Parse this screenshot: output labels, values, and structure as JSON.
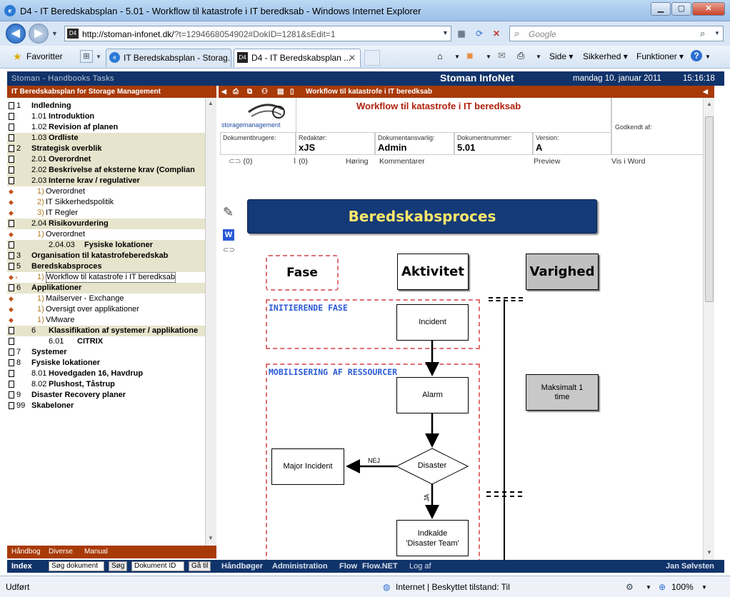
{
  "window": {
    "title": "D4 - IT Beredskabsplan - 5.01 - Workflow til katastrofe i IT beredksab - Windows Internet Explorer"
  },
  "browser": {
    "address": "http://stoman-infonet.dk/",
    "address_query": "?t=1294668054902#DokID=1281&sEdit=1",
    "search_placeholder": "Google",
    "favorites_label": "Favoritter",
    "tabs": [
      {
        "label": "IT Beredskabsplan - Storag...",
        "active": false
      },
      {
        "label": "D4 - IT Beredskabsplan ...",
        "active": true
      }
    ],
    "toolbar": {
      "side": "Side",
      "sikkerhed": "Sikkerhed",
      "funktioner": "Funktioner"
    }
  },
  "app": {
    "top_links": "Stoman - Handbooks  Tasks",
    "name": "Stoman InfoNet",
    "date": "mandag 10. januar 2011",
    "time": "15:16:18",
    "left_header": "IT Beredskabsplan for Storage Management",
    "doc_title_bar": "Workflow til katastrofe i IT beredksab"
  },
  "tree": [
    {
      "num": "1",
      "label": "Indledning",
      "type": "page",
      "hl": false
    },
    {
      "num": "1.01",
      "label": "Introduktion",
      "type": "page",
      "hl": false
    },
    {
      "num": "1.02",
      "label": "Revision af planen",
      "type": "page",
      "hl": false
    },
    {
      "num": "1.03",
      "label": "Ordliste",
      "type": "page",
      "hl": true
    },
    {
      "num": "2",
      "label": "Strategisk overblik",
      "type": "page",
      "hl": true
    },
    {
      "num": "2.01",
      "label": "Overordnet",
      "type": "page",
      "hl": true
    },
    {
      "num": "2.02",
      "label": "Beskrivelse af eksterne krav (Complian",
      "type": "page",
      "hl": true
    },
    {
      "num": "2.03",
      "label": "Interne krav / regulativer",
      "type": "page",
      "hl": true
    },
    {
      "num": "1)",
      "label": "Overordnet",
      "type": "sub",
      "hl": false
    },
    {
      "num": "2)",
      "label": "IT Sikkerhedspolitik",
      "type": "sub",
      "hl": false
    },
    {
      "num": "3)",
      "label": "IT Regler",
      "type": "sub",
      "hl": false
    },
    {
      "num": "2.04",
      "label": "Risikovurdering",
      "type": "page",
      "hl": true
    },
    {
      "num": "1)",
      "label": "Overordnet",
      "type": "sub",
      "hl": false
    },
    {
      "num": "2.04.03",
      "label": "Fysiske lokationer",
      "type": "page",
      "hl": true
    },
    {
      "num": "3",
      "label": "Organisation til katastrofeberedskab",
      "type": "page",
      "hl": true
    },
    {
      "num": "5",
      "label": "Beredskabsproces",
      "type": "page",
      "hl": true
    },
    {
      "num": "1)",
      "label": "Workflow til katastrofe i IT beredksab",
      "type": "sub",
      "hl": false,
      "selected": true
    },
    {
      "num": "6",
      "label": "Applikationer",
      "type": "page",
      "hl": true
    },
    {
      "num": "1)",
      "label": "Mailserver - Exchange",
      "type": "sub",
      "hl": false
    },
    {
      "num": "1)",
      "label": "Oversigt over applikationer",
      "type": "sub",
      "hl": false
    },
    {
      "num": "1)",
      "label": "VMware",
      "type": "sub",
      "hl": false
    },
    {
      "num": "6",
      "label": "Klassifikation af systemer / applikatione",
      "type": "page",
      "hl": true
    },
    {
      "num": "6.01",
      "label": "CITRIX",
      "type": "page",
      "hl": false
    },
    {
      "num": "7",
      "label": "Systemer",
      "type": "page",
      "hl": false
    },
    {
      "num": "8",
      "label": "Fysiske lokationer",
      "type": "page",
      "hl": false
    },
    {
      "num": "8.01",
      "label": "Hovedgaden 16, Havdrup",
      "type": "page",
      "hl": false
    },
    {
      "num": "8.02",
      "label": "Plushost, Tåstrup",
      "type": "page",
      "hl": false
    },
    {
      "num": "9",
      "label": "Disaster Recovery planer",
      "type": "page",
      "hl": false
    },
    {
      "num": "99",
      "label": "Skabeloner",
      "type": "page",
      "hl": false
    }
  ],
  "left_footer": {
    "haandbog": "Håndbog",
    "diverse": "Diverse",
    "manual": "Manual"
  },
  "doc": {
    "logo_text": "storagemanagement",
    "title": "Workflow til katastrofe i IT beredksab",
    "godkendt_label": "Godkendt af:",
    "dokumentbrugere_label": "Dokumentbrugere:",
    "redaktor_label": "Redaktør:",
    "redaktor_value": "xJS",
    "ansvarlig_label": "Dokumentansvarlig:",
    "ansvarlig_value": "Admin",
    "nummer_label": "Dokumentnummer:",
    "nummer_value": "5.01",
    "version_label": "Version:",
    "version_value": "A",
    "links_count": "(0)",
    "attach_count": "(0)",
    "horing": "Høring",
    "kommentarer": "Kommentarer",
    "preview": "Preview",
    "vis_i_word": "Vis i Word"
  },
  "diagram": {
    "banner": "Beredskabsproces",
    "col_fase": "Fase",
    "col_aktivitet": "Aktivitet",
    "col_varighed": "Varighed",
    "phase1": "INITIERENDE FASE",
    "phase2": "MOBILISERING AF RESSOURCER",
    "incident": "Incident",
    "alarm": "Alarm",
    "disaster": "Disaster",
    "major_incident": "Major Incident",
    "nej": "NEJ",
    "ja": "JA",
    "indkalde_1": "Indkalde",
    "indkalde_2": "'Disaster Team'",
    "maks_1": "Maksimalt 1",
    "maks_2": "time"
  },
  "bottom": {
    "index": "Index",
    "sog_dokument": "Søg dokument",
    "sog": "Søg",
    "dokument_id": "Dokument ID",
    "ga_til": "Gå til",
    "haandboger": "Håndbøger",
    "administration": "Administration",
    "flow": "Flow",
    "flow_net": "Flow.NET",
    "log_af": "Log af",
    "user": "Jan Sølvsten"
  },
  "status": {
    "left": "Udført",
    "zone": "Internet | Beskyttet tilstand: Til",
    "zoom": "100%"
  }
}
